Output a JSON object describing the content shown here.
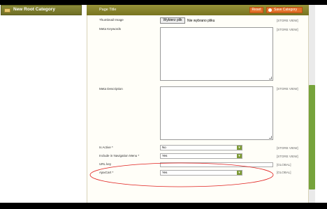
{
  "sidebar": {
    "title": "New Root Category"
  },
  "header": {
    "page_title": "Page Title",
    "reset_label": "Reset",
    "save_label": "Save Category"
  },
  "form": {
    "thumbnail": {
      "label": "Thumbnail Image",
      "button": "Wybierz plik",
      "status": "Nie wybrano pliku",
      "scope": "[STORE VIEW]"
    },
    "meta_keywords": {
      "label": "Meta Keywords",
      "scope": "[STORE VIEW]"
    },
    "meta_description": {
      "label": "Meta Description",
      "scope": "[STORE VIEW]"
    },
    "is_active": {
      "label": "Is Active *",
      "value": "No",
      "scope": "[STORE VIEW]"
    },
    "include_nav": {
      "label": "Include in Navigation Menu *",
      "value": "Yes",
      "scope": "[STORE VIEW]"
    },
    "url_key": {
      "label": "URL key",
      "scope": "[GLOBAL]"
    },
    "ajaxcart": {
      "label": "AjaxCart *",
      "value": "Yes",
      "scope": "[GLOBAL]"
    }
  },
  "colors": {
    "accent_orange": "#e3702a",
    "header_olive": "#8b8b3a",
    "annotation_red": "#e0201e"
  }
}
